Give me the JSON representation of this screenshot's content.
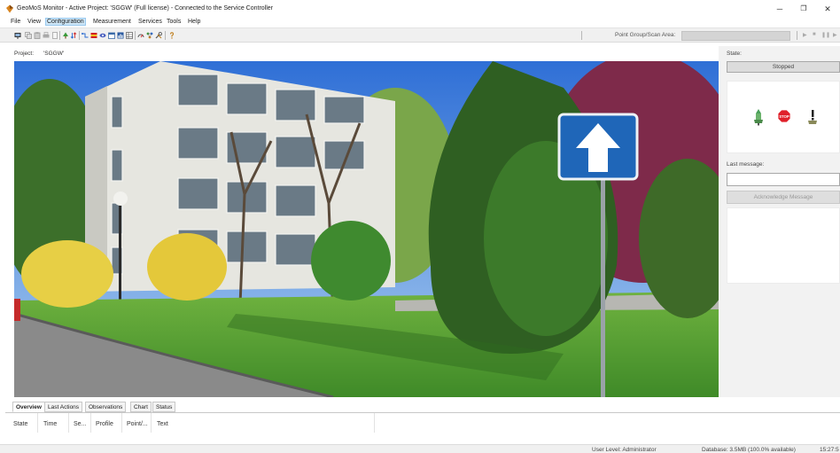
{
  "window": {
    "title": "GeoMoS Monitor - Active Project: 'SGGW' (Full license) - Connected to the Service Controller",
    "minimize": "─",
    "maximize": "❐",
    "close": "✕"
  },
  "menu": {
    "items": [
      "File",
      "View",
      "Configuration",
      "Measurement",
      "Services",
      "Tools",
      "Help"
    ],
    "active": "Configuration"
  },
  "toolbar": {
    "point_group_label": "Point Group/Scan Area:",
    "point_group_value": "",
    "playback": [
      "▶",
      "■",
      "❚❚",
      "▶"
    ]
  },
  "project": {
    "label": "Project:",
    "value": "'SGGW'"
  },
  "state_panel": {
    "state_label": "State:",
    "state_value": "Stopped",
    "last_message_label": "Last message:",
    "last_message_value": "",
    "acknowledge_label": "Acknowledge Message",
    "stop_sign_text": "STOP"
  },
  "tabs": [
    {
      "label": "Overview",
      "active": true
    },
    {
      "label": "Last Actions",
      "active": false
    },
    {
      "label": "Observations",
      "active": false
    },
    {
      "label": "Chart",
      "active": false
    },
    {
      "label": "Status",
      "active": false
    }
  ],
  "log_columns": [
    "State",
    "Time",
    "Se...",
    "Profile",
    "Point/...",
    "Text"
  ],
  "status_bar": {
    "user_level": "User Level: Administrator",
    "database": "Database: 3.5MB (100.0% available)",
    "clock": "15:27:5"
  },
  "colors": {
    "menu_highlight": "#cde6f7",
    "sign_blue": "#1f66b8",
    "stop_red": "#e0202a"
  }
}
